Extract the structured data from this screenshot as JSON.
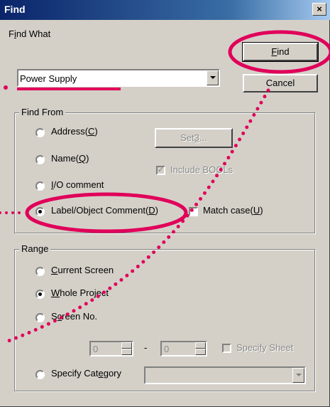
{
  "window": {
    "title": "Find",
    "close_glyph": "×"
  },
  "find_what": {
    "label_pre": "F",
    "label_mn": "i",
    "label_post": "nd What",
    "value": "Power Supply"
  },
  "buttons": {
    "find": {
      "mn": "F",
      "post": "ind"
    },
    "cancel": "Cancel",
    "set": {
      "pre": "Set",
      "mn": "3",
      "post": "..."
    }
  },
  "find_from": {
    "title": "Find From",
    "address": {
      "pre": "Address(",
      "mn": "C",
      "post": ")"
    },
    "name": {
      "pre": "Name(",
      "mn": "Q",
      "post": ")"
    },
    "io": {
      "mn": "I",
      "post": "/O comment"
    },
    "label_object": {
      "pre": "Label/Object Comment(",
      "mn": "D",
      "post": ")"
    },
    "include_bools": "Include BOOLs",
    "match_case": {
      "pre": "Match case(",
      "mn": "U",
      "post": ")"
    }
  },
  "range": {
    "title": "Range",
    "current_screen": {
      "mn": "C",
      "post": "urrent Screen"
    },
    "whole_project": {
      "mn": "W",
      "post": "hole Project"
    },
    "screen_no": {
      "pre": "S",
      "mn": "c",
      "post": "reen No."
    },
    "from_value": "0",
    "separator": "-",
    "to_value": "0",
    "specify_sheet": {
      "pre": "Speci",
      "mn": "f",
      "post": "y Sheet"
    },
    "specify_category": {
      "pre": "Specify Cat",
      "mn": "e",
      "post": "gory"
    },
    "category_value": ""
  },
  "selected": {
    "find_from": "label_object",
    "range": "whole_project"
  },
  "annotation": {
    "color": "#e0005a"
  }
}
